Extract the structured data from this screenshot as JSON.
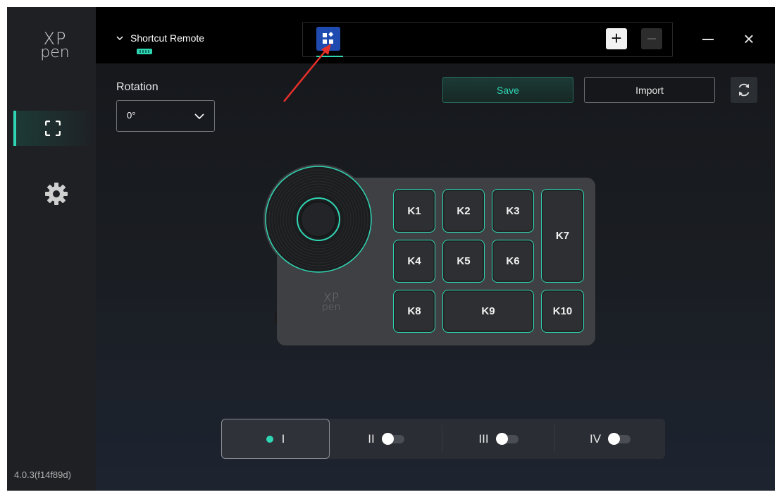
{
  "app": {
    "logo_line1": "XP",
    "logo_line2": "pen",
    "version": "4.0.3(f14f89d)",
    "accent_color": "#2fd6b4"
  },
  "sidebar": {
    "items": [
      {
        "icon": "screen-icon",
        "active": true
      },
      {
        "icon": "gear-icon",
        "active": false
      }
    ]
  },
  "header": {
    "device_name": "Shortcut Remote",
    "device_chevron_icon": "chevron-down-icon",
    "battery_icon": "battery-icon",
    "app_tab_icon": "app-grid-icon",
    "add_label": "+",
    "remove_icon": "minus-icon",
    "minimize_icon": "minimize-icon",
    "close_label": "×"
  },
  "toolbar": {
    "rotation_label": "Rotation",
    "rotation_value": "0°",
    "save_label": "Save",
    "import_label": "Import",
    "refresh_icon": "refresh-icon"
  },
  "device": {
    "logo_line1": "XP",
    "logo_line2": "pen",
    "keys": [
      "K1",
      "K2",
      "K3",
      "K4",
      "K5",
      "K6",
      "K7",
      "K8",
      "K9",
      "K10"
    ]
  },
  "modes": [
    {
      "label": "I",
      "active": true
    },
    {
      "label": "II",
      "active": false
    },
    {
      "label": "III",
      "active": false
    },
    {
      "label": "IV",
      "active": false
    }
  ]
}
